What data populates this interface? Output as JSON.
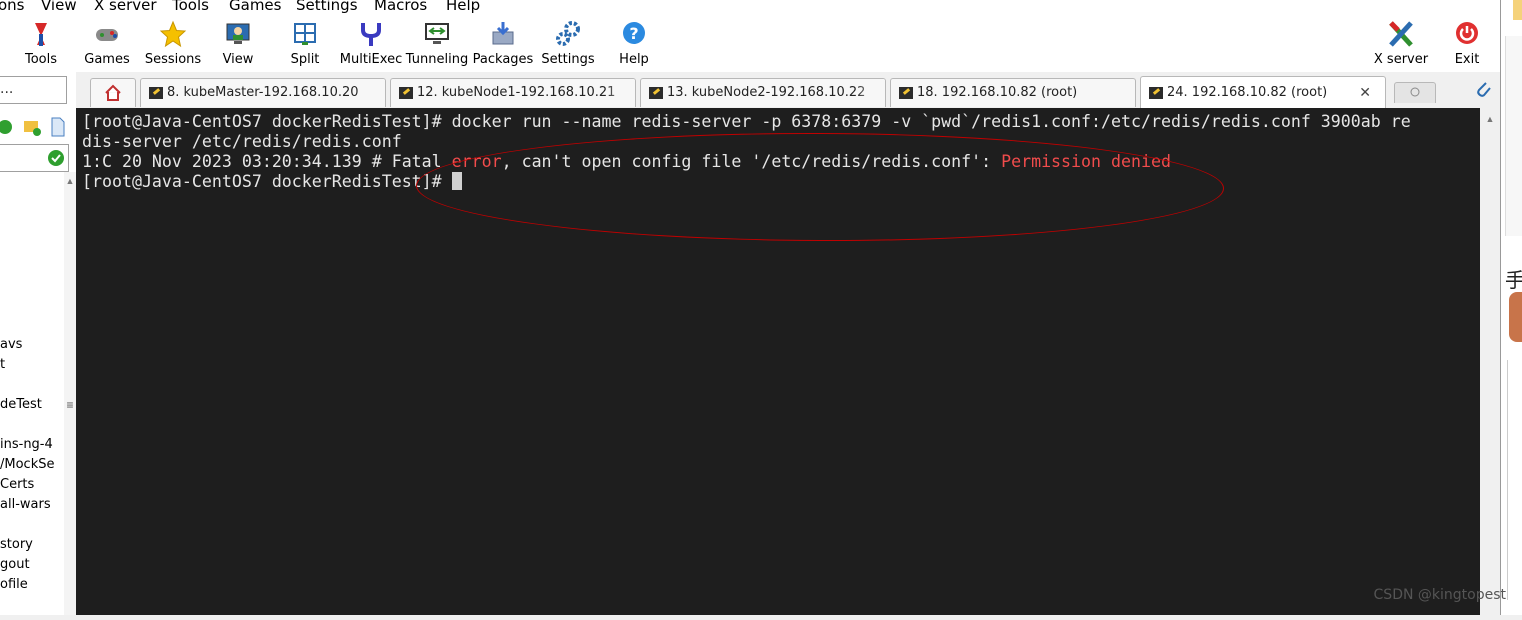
{
  "menu": [
    "ons",
    "View",
    "X server",
    "Tools",
    "Games",
    "Settings",
    "Macros",
    "Help"
  ],
  "toolbar": {
    "tools": "Tools",
    "games": "Games",
    "sessions": "Sessions",
    "view": "View",
    "split": "Split",
    "multiexec": "MultiExec",
    "tunneling": "Tunneling",
    "packages": "Packages",
    "settings": "Settings",
    "help": "Help",
    "xserver": "X server",
    "exit": "Exit"
  },
  "sidebar": {
    "quick_connect": "...",
    "tree": [
      "avs",
      "t",
      "deTest",
      "ins-ng-4",
      "/MockSe",
      "Certs",
      "all-wars",
      "story",
      "gout",
      "ofile"
    ]
  },
  "tabs": [
    {
      "label": "8. kubeMaster-192.168.10.20"
    },
    {
      "label": "12. kubeNode1-192.168.10.21"
    },
    {
      "label": "13. kubeNode2-192.168.10.22"
    },
    {
      "label": "18. 192.168.10.82 (root)"
    },
    {
      "label": "24. 192.168.10.82 (root)",
      "active": true
    }
  ],
  "terminal": {
    "line1": "[root@Java-CentOS7 dockerRedisTest]# docker run --name redis-server -p 6378:6379 -v `pwd`/redis1.conf:/etc/redis/redis.conf 3900ab re",
    "line2": "dis-server /etc/redis/redis.conf",
    "line3_a": "1:C 20 Nov 2023 03:20:34.139 # Fatal ",
    "line3_b": "error",
    "line3_c": ", can't open config file '/etc/redis/redis.conf': ",
    "line3_d": "Permission denied",
    "line4": "[root@Java-CentOS7 dockerRedisTest]# "
  },
  "right_strip": {
    "char": "手"
  },
  "watermark": "CSDN @kingtopest",
  "colors": {
    "terminal_bg": "#1e1e1e",
    "error_red": "#f14c4c",
    "annotation": "#c00000"
  }
}
